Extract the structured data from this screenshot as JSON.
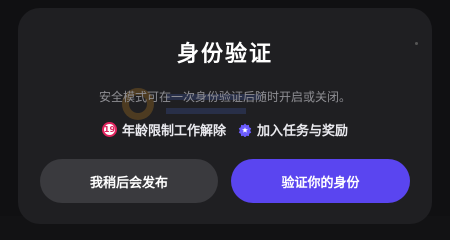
{
  "dialog": {
    "title": "身份验证",
    "subtitle": "安全模式可在一次身份验证后随时开启或关闭。",
    "features": [
      {
        "icon": "age-19-icon",
        "age_badge": "19",
        "label": "年龄限制工作解除"
      },
      {
        "icon": "star-badge-icon",
        "label": "加入任务与奖励"
      }
    ],
    "buttons": {
      "later": "我稍后会发布",
      "verify": "验证你的身份"
    }
  },
  "colors": {
    "dialog_bg": "#1f1f22",
    "primary_button": "#5a45f0",
    "secondary_button": "#3a3a3e",
    "badge_accent": "#e0245e",
    "verify_badge": "#6b5cff"
  }
}
